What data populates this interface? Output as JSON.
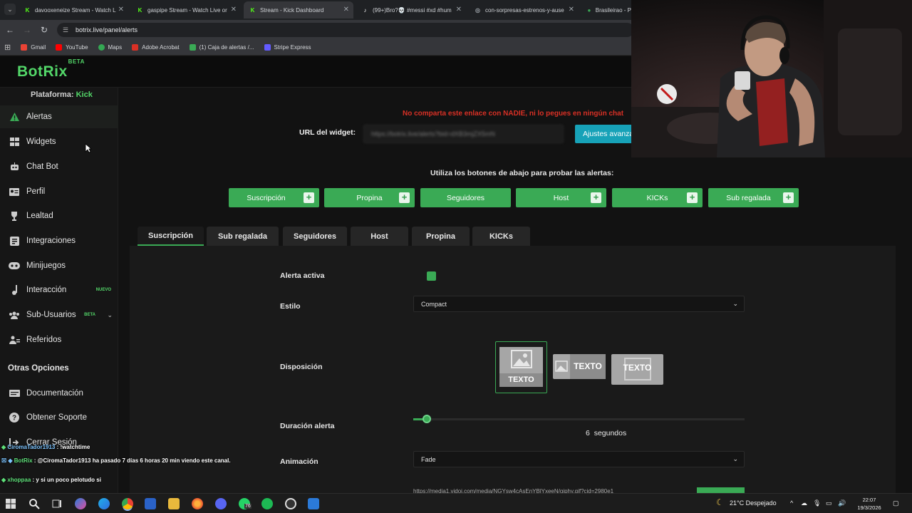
{
  "browser": {
    "tabs": [
      {
        "title": "davooxeneize Stream - Watch L",
        "fav_color": "#53fc18",
        "fav": "K"
      },
      {
        "title": "gaspipe Stream - Watch Live or",
        "fav_color": "#53fc18",
        "fav": "K"
      },
      {
        "title": "Stream - Kick Dashboard",
        "fav_color": "#53fc18",
        "fav": "K"
      },
      {
        "title": "(99+)Bro?💀 #messi #xd #hum",
        "fav_color": "#ffffff",
        "fav": "♪"
      },
      {
        "title": "con-sorpresas-estrenos-y-ause",
        "fav_color": "#9aa0a6",
        "fav": "◎"
      },
      {
        "title": "Brasileirao - P",
        "fav_color": "#3aaa55",
        "fav": "●"
      }
    ],
    "url": "botrix.live/panel/alerts",
    "bookmarks": [
      {
        "label": "Gmail",
        "color": "#ea4335"
      },
      {
        "label": "YouTube",
        "color": "#ff0000"
      },
      {
        "label": "Maps",
        "color": "#34a853"
      },
      {
        "label": "Adobe Acrobat",
        "color": "#d93025"
      },
      {
        "label": "(1) Caja de alertas /...",
        "color": "#3aaa55"
      },
      {
        "label": "Stripe Express",
        "color": "#635bff"
      }
    ]
  },
  "app": {
    "logo": "BotRix",
    "logo_badge": "BETA",
    "platform_label": "Plataforma:",
    "platform_value": "Kick",
    "nav": [
      {
        "label": "Alertas",
        "icon": "warning-icon"
      },
      {
        "label": "Widgets",
        "icon": "widgets-icon"
      },
      {
        "label": "Chat Bot",
        "icon": "robot-icon"
      },
      {
        "label": "Perfil",
        "icon": "profile-card-icon"
      },
      {
        "label": "Lealtad",
        "icon": "trophy-icon"
      },
      {
        "label": "Integraciones",
        "icon": "integrations-icon"
      },
      {
        "label": "Minijuegos",
        "icon": "gamepad-icon"
      },
      {
        "label": "Interacción",
        "icon": "music-note-icon",
        "badge": "NUEVO"
      },
      {
        "label": "Sub-Usuarios",
        "icon": "users-icon",
        "badge": "BETA"
      },
      {
        "label": "Referidos",
        "icon": "referrals-icon"
      }
    ],
    "other_title": "Otras Opciones",
    "other": [
      {
        "label": "Documentación",
        "icon": "document-icon"
      },
      {
        "label": "Obtener Soporte",
        "icon": "help-icon"
      },
      {
        "label": "Cerrar Sesión",
        "icon": "logout-icon"
      }
    ]
  },
  "content": {
    "warning": "No comparta este enlace con NADIE, ni lo pegues en ningún chat",
    "widget_url_label": "URL del widget:",
    "widget_url_value": "https://botrix.live/alerts?bid=dXB3mjZX5mN",
    "advanced_button": "Ajustes avanzados",
    "test_label": "Utiliza los botones de abajo para probar las alertas:",
    "test_buttons": [
      "Suscripción",
      "Propina",
      "Seguidores",
      "Host",
      "KICKs",
      "Sub regalada"
    ],
    "tabs": [
      "Suscripción",
      "Sub regalada",
      "Seguidores",
      "Host",
      "Propina",
      "KICKs"
    ],
    "active_tab": "Suscripción",
    "form": {
      "alert_active_label": "Alerta activa",
      "alert_active": true,
      "style_label": "Estilo",
      "style_value": "Compact",
      "layout_label": "Disposición",
      "layout_text": "TEXTO",
      "duration_label": "Duración alerta",
      "duration_value": "6",
      "duration_unit": "segundos",
      "duration_fraction": 0.04,
      "animation_label": "Animación",
      "animation_value": "Fade",
      "sound_url": "https://media1.vidoi.com/media/NGYsw4cAsEnYBlYxeeN/giphy.gif?cid=2980e1"
    }
  },
  "chat": [
    {
      "user": "CiromaTador1913",
      "text": ": !watchtime"
    },
    {
      "user": "BotRix",
      "text": ": @CiromaTador1913 ha pasado 7 días 6 horas 20 min viendo este canal."
    },
    {
      "user": "xhoppaa",
      "text": ": y si un poco pelotudo si"
    }
  ],
  "taskbar": {
    "weather": "21°C Despejado",
    "time": "22:07",
    "date": "19/3/2026",
    "whatsapp_badge": "76"
  }
}
